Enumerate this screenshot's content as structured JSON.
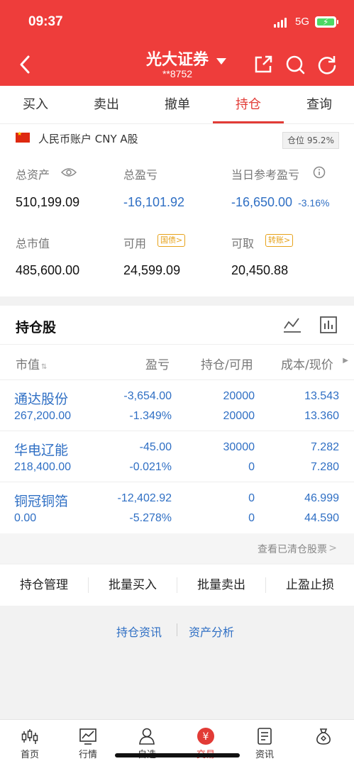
{
  "status": {
    "time": "09:37",
    "network": "5G"
  },
  "header": {
    "title": "光大证券",
    "account_mask": "**8752"
  },
  "tabs": [
    {
      "label": "买入"
    },
    {
      "label": "卖出"
    },
    {
      "label": "撤单"
    },
    {
      "label": "持仓"
    },
    {
      "label": "查询"
    }
  ],
  "account": {
    "name": "人民币账户 CNY A股",
    "position_label": "仓位 95.2%"
  },
  "summary": {
    "total_assets_label": "总资产",
    "total_assets": "510,199.09",
    "total_pl_label": "总盈亏",
    "total_pl": "-16,101.92",
    "day_pl_label": "当日参考盈亏",
    "day_pl": "-16,650.00",
    "day_pl_pct": "-3.16%",
    "market_value_label": "总市值",
    "market_value": "485,600.00",
    "available_label": "可用",
    "available_tag": "国债>",
    "available": "24,599.09",
    "withdrawable_label": "可取",
    "withdrawable_tag": "转账>",
    "withdrawable": "20,450.88"
  },
  "holdings": {
    "title": "持仓股",
    "headers": {
      "market_value": "市值",
      "pl": "盈亏",
      "qty": "持仓/可用",
      "cost": "成本/现价"
    },
    "rows": [
      {
        "name": "通达股份",
        "mv": "267,200.00",
        "pl": "-3,654.00",
        "pl_pct": "-1.349%",
        "qty": "20000",
        "avail": "20000",
        "cost": "13.543",
        "price": "13.360"
      },
      {
        "name": "华电辽能",
        "mv": "218,400.00",
        "pl": "-45.00",
        "pl_pct": "-0.021%",
        "qty": "30000",
        "avail": "0",
        "cost": "7.282",
        "price": "7.280"
      },
      {
        "name": "铜冠铜箔",
        "mv": "0.00",
        "pl": "-12,402.92",
        "pl_pct": "-5.278%",
        "qty": "0",
        "avail": "0",
        "cost": "46.999",
        "price": "44.590"
      }
    ],
    "cleared_link": "查看已清仓股票"
  },
  "actions": [
    {
      "label": "持仓管理"
    },
    {
      "label": "批量买入"
    },
    {
      "label": "批量卖出"
    },
    {
      "label": "止盈止损"
    }
  ],
  "links": {
    "holdings_news": "持仓资讯",
    "asset_analysis": "资产分析"
  },
  "bottom_nav": [
    {
      "label": "首页"
    },
    {
      "label": "行情"
    },
    {
      "label": "自选"
    },
    {
      "label": "交易"
    },
    {
      "label": "资讯"
    },
    {
      "label": ""
    }
  ],
  "colors": {
    "brand_red": "#ee3d3b",
    "loss_blue": "#2f6fc4",
    "tag_orange": "#e7a21a"
  }
}
